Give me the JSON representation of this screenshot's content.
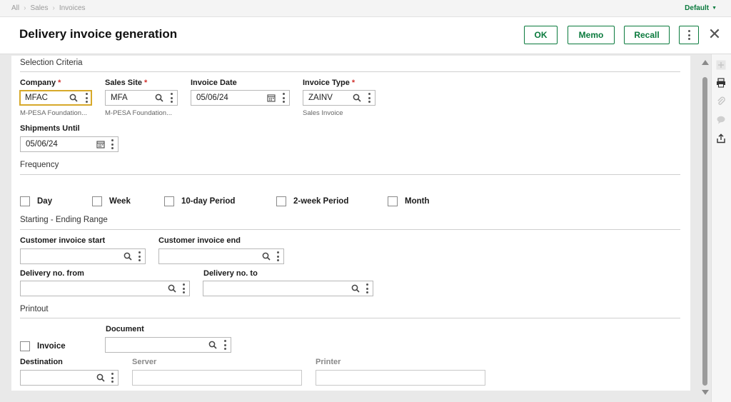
{
  "breadcrumb": {
    "items": [
      "All",
      "Sales",
      "Invoices"
    ]
  },
  "profile": {
    "label": "Default"
  },
  "page": {
    "title": "Delivery invoice generation"
  },
  "actions": {
    "ok": "OK",
    "memo": "Memo",
    "recall": "Recall"
  },
  "selection": {
    "title": "Selection Criteria",
    "company": {
      "label": "Company",
      "value": "MFAC",
      "desc": "M-PESA Foundation..."
    },
    "sales_site": {
      "label": "Sales Site",
      "value": "MFA",
      "desc": "M-PESA Foundation..."
    },
    "invoice_date": {
      "label": "Invoice Date",
      "value": "05/06/24"
    },
    "invoice_type": {
      "label": "Invoice Type",
      "value": "ZAINV",
      "desc": "Sales Invoice"
    },
    "shipments_until": {
      "label": "Shipments Until",
      "value": "05/06/24"
    }
  },
  "frequency": {
    "title": "Frequency",
    "options": [
      "Day",
      "Week",
      "10-day Period",
      "2-week Period",
      "Month"
    ]
  },
  "range": {
    "title": "Starting - Ending Range",
    "cust_start": "Customer invoice start",
    "cust_end": "Customer invoice end",
    "delivery_from": "Delivery no. from",
    "delivery_to": "Delivery no. to"
  },
  "printout": {
    "title": "Printout",
    "invoice": "Invoice",
    "document": "Document",
    "destination": "Destination",
    "server": "Server",
    "printer": "Printer"
  },
  "colors": {
    "accent": "#0a7a3d",
    "focus": "#d7a92a",
    "required": "#d0312d"
  }
}
